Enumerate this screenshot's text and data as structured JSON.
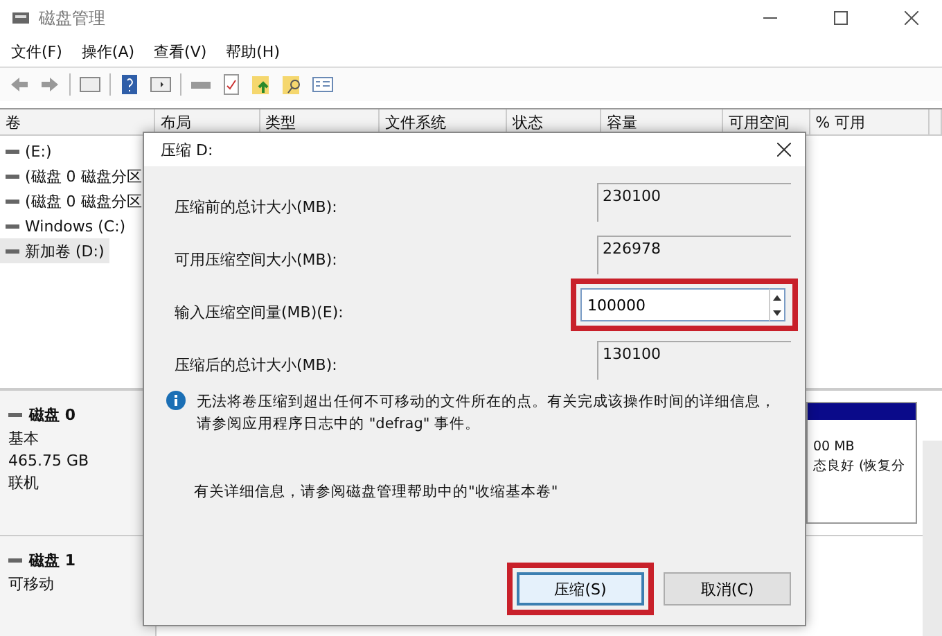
{
  "window": {
    "title": "磁盘管理"
  },
  "menu": [
    "文件(F)",
    "操作(A)",
    "查看(V)",
    "帮助(H)"
  ],
  "table": {
    "columns": [
      "卷",
      "布局",
      "类型",
      "文件系统",
      "状态",
      "容量",
      "可用空间",
      "% 可用"
    ],
    "rows": [
      {
        "volume": "(E:)",
        "selected": false
      },
      {
        "volume": "(磁盘 0 磁盘分区",
        "selected": false
      },
      {
        "volume": "(磁盘 0 磁盘分区",
        "selected": false
      },
      {
        "volume": "Windows (C:)",
        "selected": false
      },
      {
        "volume": "新加卷 (D:)",
        "selected": true
      }
    ]
  },
  "disks": [
    {
      "name": "磁盘 0",
      "lines": [
        "基本",
        "465.75 GB",
        "联机"
      ],
      "partition": {
        "lines": [
          "00 MB",
          "态良好 (恢复分"
        ]
      }
    },
    {
      "name": "磁盘 1",
      "lines": [
        "可移动"
      ]
    }
  ],
  "dialog": {
    "title": "压缩 D:",
    "fields": [
      {
        "kind": "readonly",
        "label": "压缩前的总计大小(MB):",
        "value": "230100"
      },
      {
        "kind": "readonly",
        "label": "可用压缩空间大小(MB):",
        "value": "226978"
      },
      {
        "kind": "spin",
        "label": "输入压缩空间量(MB)(E):",
        "value": "100000",
        "highlighted": true
      },
      {
        "kind": "readonly",
        "label": "压缩后的总计大小(MB):",
        "value": "130100"
      }
    ],
    "info": "无法将卷压缩到超出任何不可移动的文件所在的点。有关完成该操作时间的详细信息，请参阅应用程序日志中的 \"defrag\" 事件。",
    "help": "有关详细信息，请参阅磁盘管理帮助中的\"收缩基本卷\"",
    "buttons": [
      {
        "label": "压缩(S)",
        "default": true,
        "highlighted": true
      },
      {
        "label": "取消(C)",
        "default": false,
        "highlighted": false
      }
    ]
  }
}
